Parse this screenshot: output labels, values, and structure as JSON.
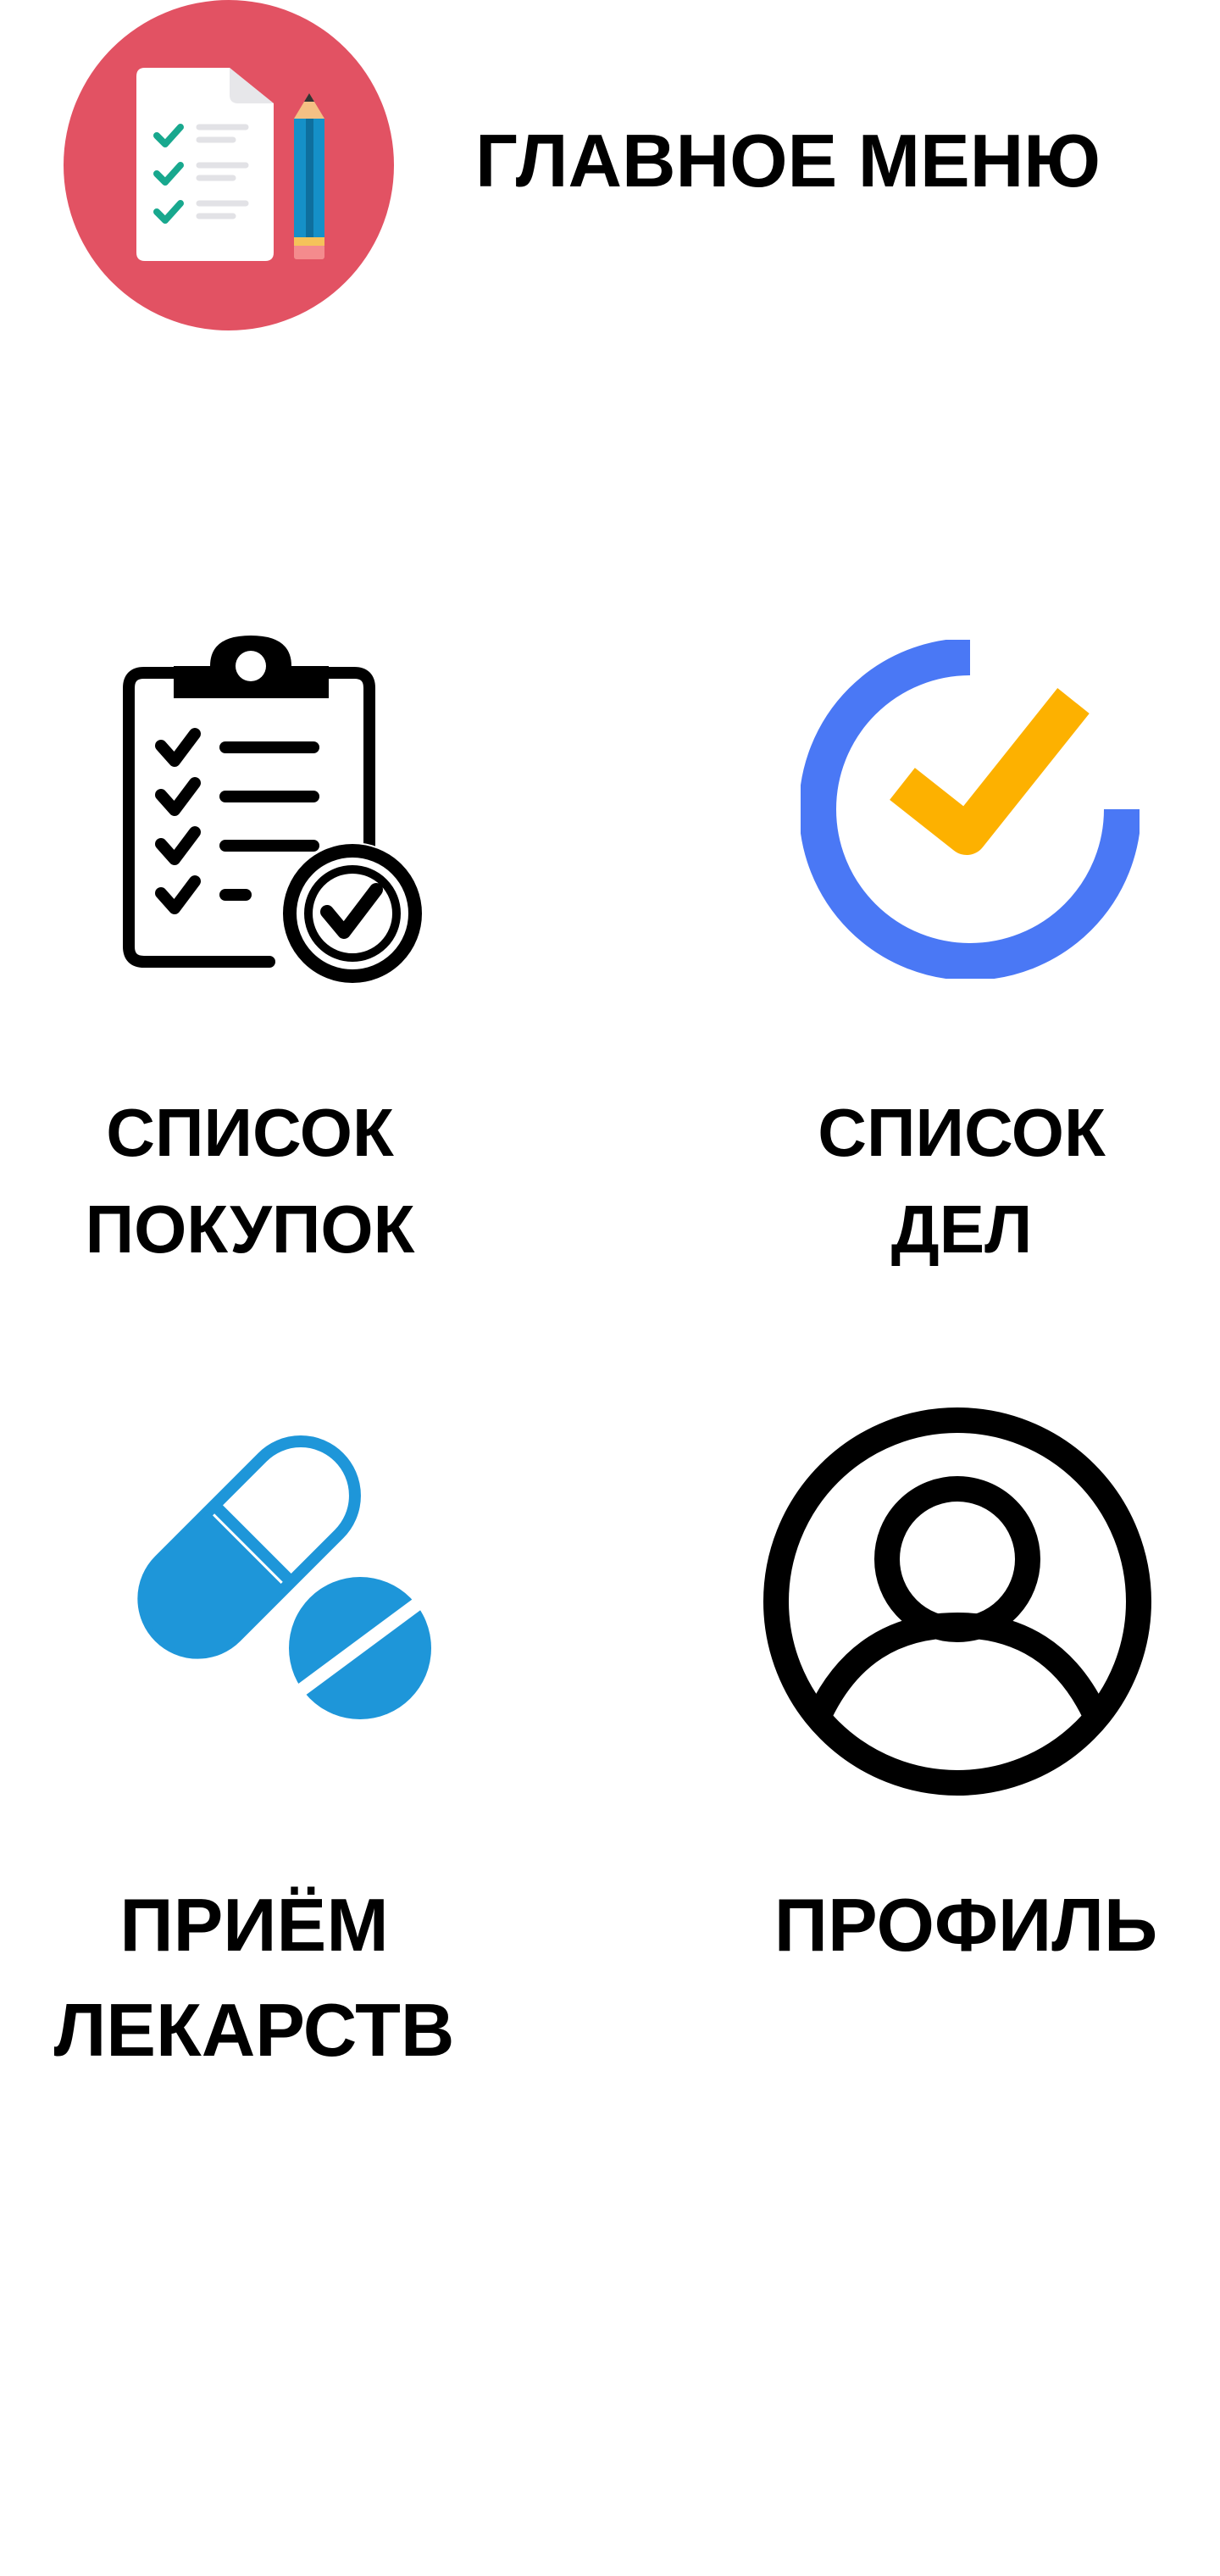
{
  "header": {
    "title": "ГЛАВНОЕ МЕНЮ",
    "logo_icon": "checklist-pencil-logo-icon",
    "logo_color": "#e25263"
  },
  "menu": {
    "items": [
      {
        "id": "shopping",
        "label_lines": [
          "СПИСОК",
          "ПОКУПОК"
        ],
        "icon": "clipboard-checklist-icon"
      },
      {
        "id": "todo",
        "label_lines": [
          "СПИСОК",
          "ДЕЛ"
        ],
        "icon": "circular-checkmark-icon"
      },
      {
        "id": "medicine",
        "label_lines": [
          "ПРИЁМ",
          "ЛЕКАРСТВ"
        ],
        "icon": "pills-icon"
      },
      {
        "id": "profile",
        "label_lines": [
          "ПРОФИЛЬ"
        ],
        "icon": "user-profile-icon"
      }
    ]
  },
  "colors": {
    "todo_ring": "#4a78f5",
    "todo_check": "#fdb100",
    "pills": "#1e96d9",
    "text": "#000000"
  }
}
